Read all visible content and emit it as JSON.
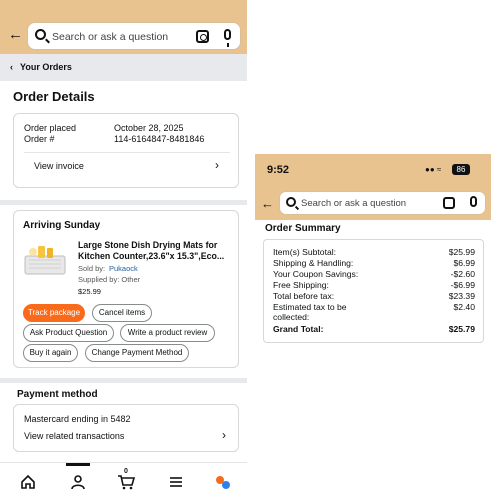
{
  "left": {
    "search": {
      "placeholder": "Search or ask a question"
    },
    "breadcrumb": {
      "chevron": "‹",
      "label": "Your Orders"
    },
    "page_title": "Order Details",
    "order_info": {
      "placed_label": "Order placed",
      "placed_value": "October 28, 2025",
      "number_label": "Order #",
      "number_value": "114-6164847-8481846",
      "invoice_label": "View invoice"
    },
    "shipment": {
      "heading": "Arriving Sunday",
      "product_title_line1": "Large Stone Dish Drying Mats for",
      "product_title_line2": "Kitchen Counter,23.6\"x 15.3\",Eco...",
      "sold_by_label": "Sold by:",
      "sold_by_value": "Pukaock",
      "supplied_by": "Supplied by: Other",
      "price": "$25.99",
      "buttons": {
        "track": "Track package",
        "cancel": "Cancel items",
        "ask": "Ask Product Question",
        "review": "Write a product review",
        "buy_again": "Buy it again",
        "change_payment": "Change Payment Method"
      }
    },
    "payment": {
      "heading": "Payment method",
      "card": "Mastercard  ending in 5482",
      "transactions": "View related transactions"
    },
    "bottom_nav": {
      "items": [
        "home-icon",
        "account-icon",
        "cart-icon",
        "menu-icon",
        "rufus-icon"
      ],
      "cart_count": "0"
    },
    "colors": {
      "header": "#e9c38f",
      "accent": "#fa6a1b",
      "link": "#2162a1"
    }
  },
  "right": {
    "status": {
      "time": "9:52",
      "battery": "86"
    },
    "search": {
      "placeholder": "Search or ask a question"
    },
    "summary": {
      "title": "Order Summary",
      "rows": [
        {
          "label": "Item(s) Subtotal:",
          "value": "$25.99"
        },
        {
          "label": "Shipping & Handling:",
          "value": "$6.99"
        },
        {
          "label": "Your Coupon Savings:",
          "value": "-$2.60"
        },
        {
          "label": "Free Shipping:",
          "value": "-$6.99"
        },
        {
          "label": "Total before tax:",
          "value": "$23.39"
        },
        {
          "label": "Estimated tax to be collected:",
          "value": "$2.40"
        },
        {
          "label": "Grand Total:",
          "value": "$25.79"
        }
      ]
    }
  }
}
